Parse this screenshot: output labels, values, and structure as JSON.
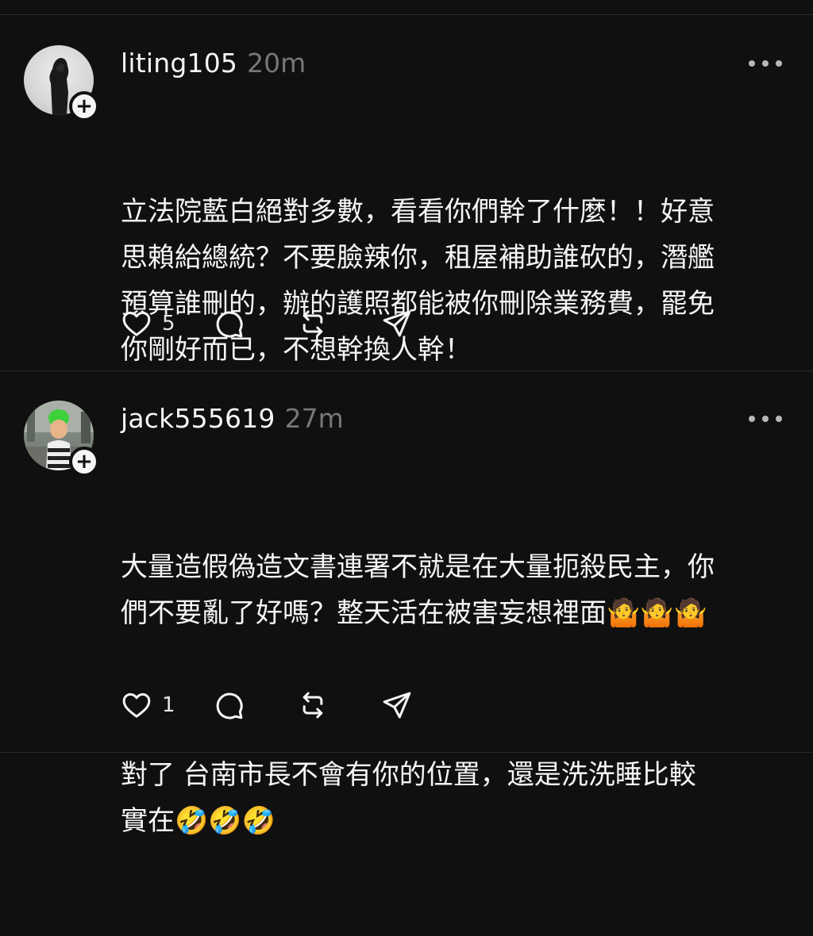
{
  "posts": [
    {
      "username": "liting105",
      "time": "20m",
      "paragraphs": [
        "立法院藍白絕對多數，看看你們幹了什麼！！好意\n思賴給總統？不要臉辣你，租屋補助誰砍的，潛艦\n預算誰刪的，辦的護照都能被你刪除業務費，罷免\n你剛好而已，不想幹換人幹！"
      ],
      "like_count": "5",
      "icons": [
        "heart-icon",
        "comment-icon",
        "repost-icon",
        "share-icon"
      ]
    },
    {
      "username": "jack555619",
      "time": "27m",
      "paragraphs": [
        "大量造假偽造文書連署不就是在大量扼殺民主，你\n們不要亂了好嗎？整天活在被害妄想裡面🤷🤷🤷",
        "對了 台南市長不會有你的位置，還是洗洗睡比較\n實在🤣🤣🤣"
      ],
      "like_count": "1",
      "icons": [
        "heart-icon",
        "comment-icon",
        "repost-icon",
        "share-icon"
      ]
    }
  ],
  "plus_symbol": "+",
  "colors": {
    "background": "#101010",
    "text": "#f3f5f7",
    "muted": "#777777",
    "divider": "#2a2a2a"
  }
}
